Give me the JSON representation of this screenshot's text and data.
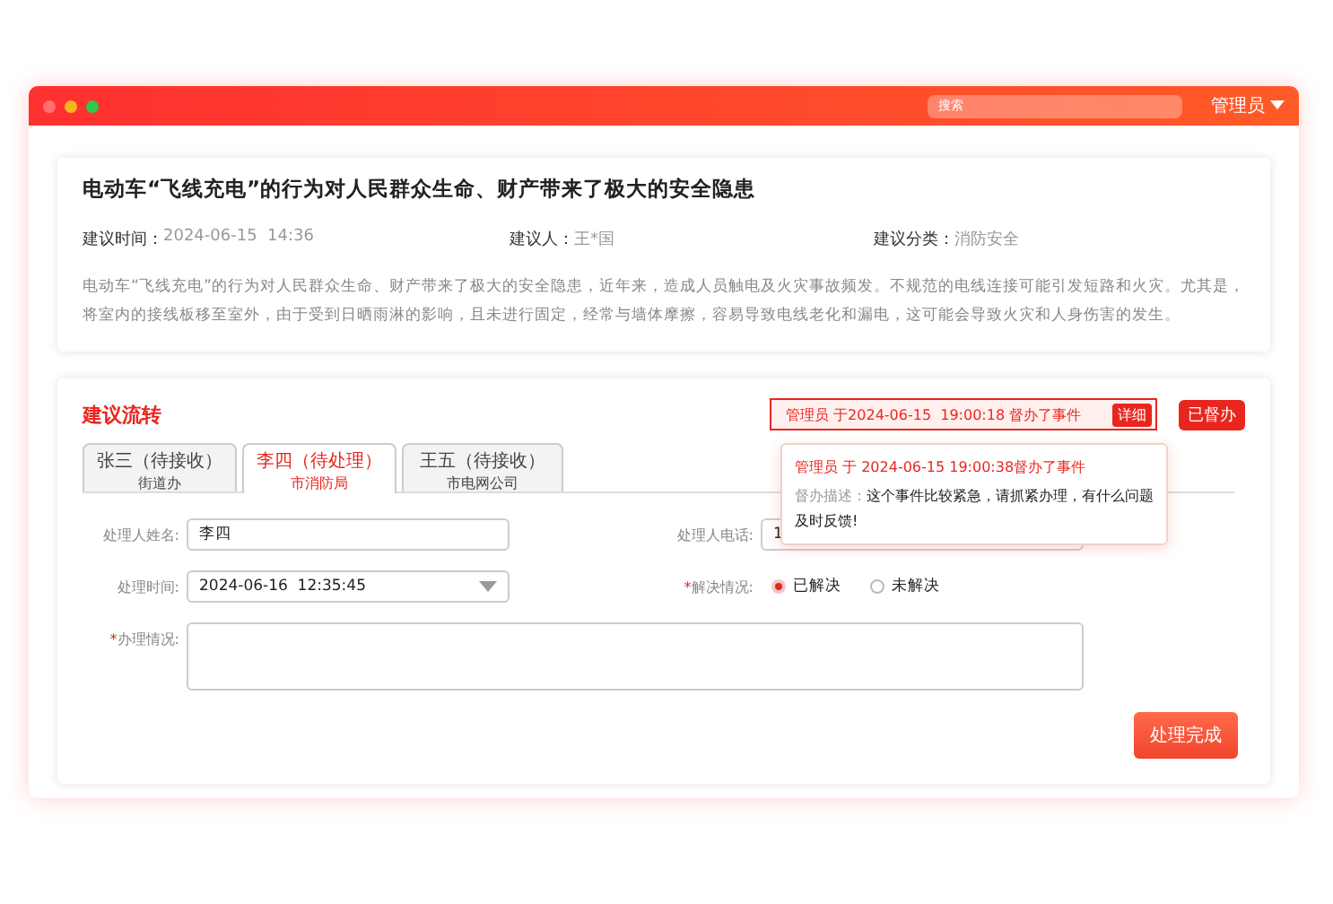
{
  "window": {
    "search": {
      "placeholder": "搜索"
    },
    "user": "管理员"
  },
  "suggestion": {
    "title": "电动车“飞线充电”的行为对人民群众生命、财产带来了极大的安全隐患",
    "meta": [
      {
        "label": "建议时间：",
        "value": "2024-06-15  14:36"
      },
      {
        "label": "建议人：",
        "value": "王*国"
      },
      {
        "label": "建议分类：",
        "value": "消防安全"
      }
    ],
    "description": "电动车“飞线充电”的行为对人民群众生命、财产带来了极大的安全隐患，近年来，造成人员触电及火灾事故频发。不规范的电线连接可能引发短路和火灾。尤其是，将室内的接线板移至室外，由于受到日晒雨淋的影响，且未进行固定，经常与墙体摩擦，容易导致电线老化和漏电，这可能会导致火灾和人身伤害的发生。"
  },
  "flow": {
    "title": "建议流转",
    "notice": {
      "text": "管理员 于2024-06-15  19:00:18 督办了事件",
      "action": "详细"
    },
    "status_badge": "已督办",
    "popover": {
      "title": "管理员 于 2024-06-15 19:00:38督办了事件",
      "desc_label": "督办描述：",
      "desc": "这个事件比较紧急，请抓紧办理，有什么问题及时反馈!"
    },
    "tabs": [
      {
        "name": "张三（待接收）",
        "dept": "街道办",
        "selected": false
      },
      {
        "name": "李四（待处理）",
        "dept": "市消防局",
        "selected": true
      },
      {
        "name": "王五（待接收）",
        "dept": "市电网公司",
        "selected": false
      }
    ],
    "form": {
      "name_label": {
        "text": "处理人姓名:"
      },
      "name_value": "李四",
      "phone_label": {
        "text": "处理人电话:"
      },
      "phone_value": "1",
      "time_label": {
        "text": "处理时间:"
      },
      "time_value": "2024-06-16  12:35:45",
      "resolve_label": {
        "mark": "*",
        "text": "解决情况:"
      },
      "options": [
        {
          "label": "已解决",
          "selected": true
        },
        {
          "label": "未解决",
          "selected": false
        }
      ],
      "detail_label": {
        "mark": "*",
        "text": "办理情况:"
      }
    },
    "submit": "处理完成"
  }
}
